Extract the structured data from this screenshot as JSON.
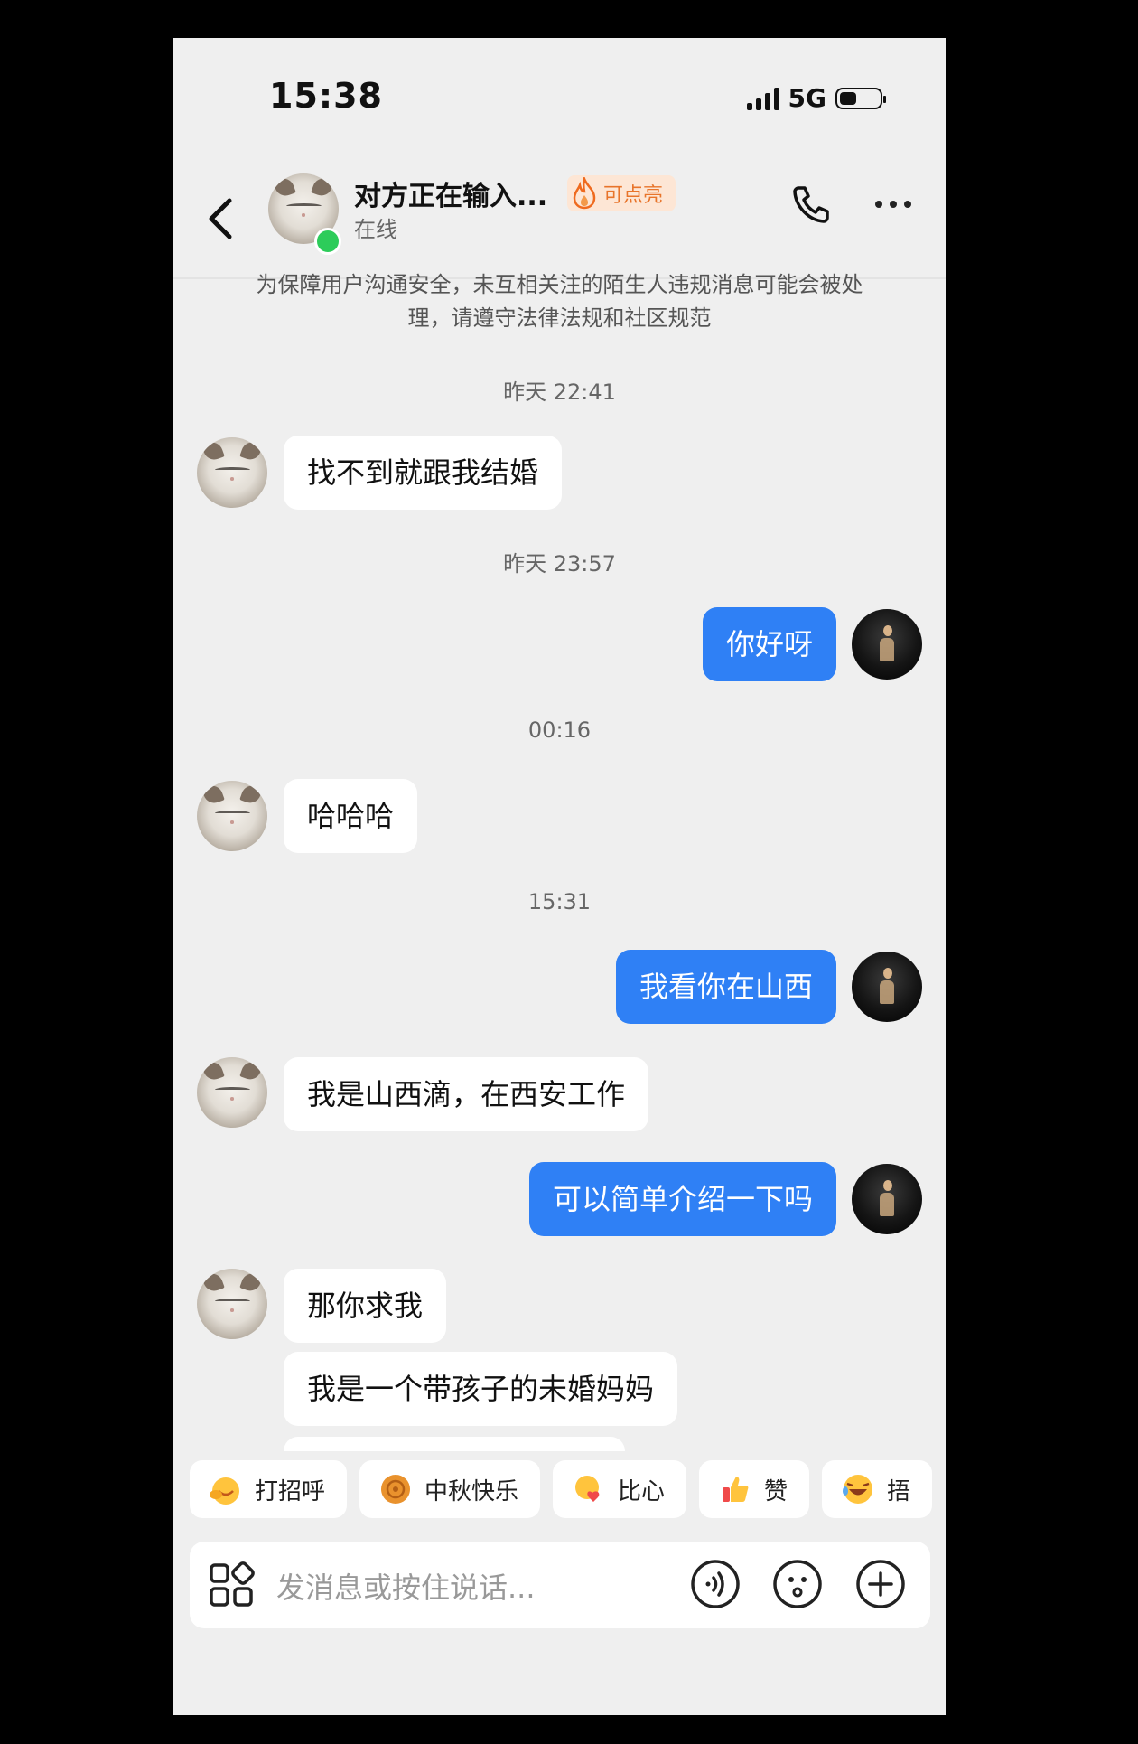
{
  "status_bar": {
    "time": "15:38",
    "network": "5G"
  },
  "header": {
    "contact_name": "对方正在输入...",
    "badge_text": "可点亮",
    "presence": "在线"
  },
  "notice": "为保障用户沟通安全，未互相关注的陌生人违规消息可能会被处理，请遵守法律法规和社区规范",
  "conversation": {
    "timestamps": [
      "昨天 22:41",
      "昨天 23:57",
      "00:16",
      "15:31"
    ],
    "messages": [
      {
        "from": "them",
        "text": "找不到就跟我结婚"
      },
      {
        "from": "me",
        "text": "你好呀"
      },
      {
        "from": "them",
        "text": "哈哈哈"
      },
      {
        "from": "me",
        "text": "我看你在山西"
      },
      {
        "from": "them",
        "text": "我是山西滴，在西安工作"
      },
      {
        "from": "me",
        "text": "可以简单介绍一下吗"
      },
      {
        "from": "them",
        "text": "那你求我"
      },
      {
        "from": "them",
        "text": "我是一个带孩子的未婚妈妈"
      }
    ]
  },
  "quick_replies": [
    {
      "label": "打招呼",
      "icon": "waving-face-icon"
    },
    {
      "label": "中秋快乐",
      "icon": "mooncake-icon"
    },
    {
      "label": "比心",
      "icon": "heart-hands-icon"
    },
    {
      "label": "赞",
      "icon": "thumbs-up-icon"
    },
    {
      "label": "捂",
      "icon": "laughing-face-icon"
    }
  ],
  "input": {
    "placeholder": "发消息或按住说话..."
  },
  "colors": {
    "outgoing_bubble": "#2f80f5",
    "background": "#efefef",
    "online": "#2dcc5a"
  }
}
